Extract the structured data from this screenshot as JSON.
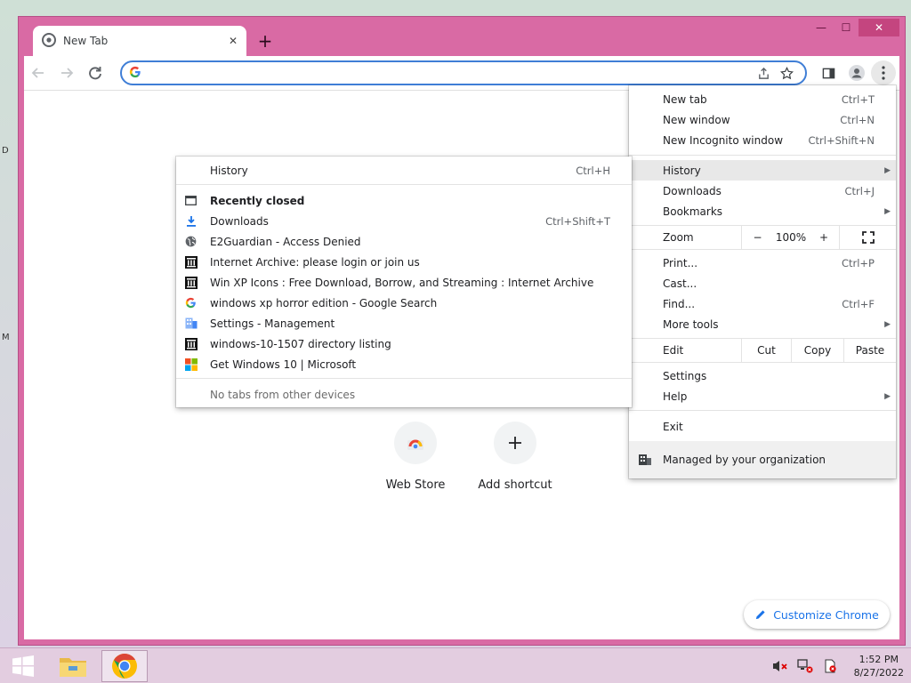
{
  "desktop": {
    "edge_letters": [
      "D",
      "M"
    ]
  },
  "window": {
    "minimize": "—",
    "maximize": "☐",
    "close": "✕"
  },
  "tab": {
    "title": "New Tab",
    "close": "✕",
    "new_tab": "+"
  },
  "toolbar": {
    "omnibox_value": "",
    "omnibox_placeholder": ""
  },
  "page": {
    "shortcuts": [
      {
        "label": "Web Store"
      },
      {
        "label": "Add shortcut"
      }
    ],
    "customize_label": "Customize Chrome"
  },
  "main_menu": {
    "new_tab": {
      "label": "New tab",
      "shortcut": "Ctrl+T"
    },
    "new_window": {
      "label": "New window",
      "shortcut": "Ctrl+N"
    },
    "new_incognito": {
      "label": "New Incognito window",
      "shortcut": "Ctrl+Shift+N"
    },
    "history": {
      "label": "History"
    },
    "downloads": {
      "label": "Downloads",
      "shortcut": "Ctrl+J"
    },
    "bookmarks": {
      "label": "Bookmarks"
    },
    "zoom": {
      "label": "Zoom",
      "minus": "−",
      "value": "100%",
      "plus": "+"
    },
    "print": {
      "label": "Print...",
      "shortcut": "Ctrl+P"
    },
    "cast": {
      "label": "Cast..."
    },
    "find": {
      "label": "Find...",
      "shortcut": "Ctrl+F"
    },
    "more_tools": {
      "label": "More tools"
    },
    "edit": {
      "label": "Edit",
      "cut": "Cut",
      "copy": "Copy",
      "paste": "Paste"
    },
    "settings": {
      "label": "Settings"
    },
    "help": {
      "label": "Help"
    },
    "exit": {
      "label": "Exit"
    },
    "managed": {
      "label": "Managed by your organization"
    }
  },
  "history_menu": {
    "history": {
      "label": "History",
      "shortcut": "Ctrl+H"
    },
    "recently_closed": "Recently closed",
    "items": [
      {
        "label": "Downloads",
        "shortcut": "Ctrl+Shift+T",
        "icon": "download-icon"
      },
      {
        "label": "E2Guardian - Access Denied",
        "shortcut": "",
        "icon": "globe-icon"
      },
      {
        "label": "Internet Archive: please login or join us",
        "shortcut": "",
        "icon": "archive-icon"
      },
      {
        "label": "Win XP Icons : Free Download, Borrow, and Streaming : Internet Archive",
        "shortcut": "",
        "icon": "archive-icon"
      },
      {
        "label": "windows xp horror edition - Google Search",
        "shortcut": "",
        "icon": "google-icon"
      },
      {
        "label": "Settings - Management",
        "shortcut": "",
        "icon": "building-icon"
      },
      {
        "label": "windows-10-1507 directory listing",
        "shortcut": "",
        "icon": "archive-icon"
      },
      {
        "label": "Get Windows 10 | Microsoft",
        "shortcut": "",
        "icon": "microsoft-icon"
      }
    ],
    "no_tabs": "No tabs from other devices"
  },
  "taskbar": {
    "time": "1:52 PM",
    "date": "8/27/2022"
  },
  "colors": {
    "window_frame": "#d96aa4",
    "accent": "#1a73e8"
  }
}
